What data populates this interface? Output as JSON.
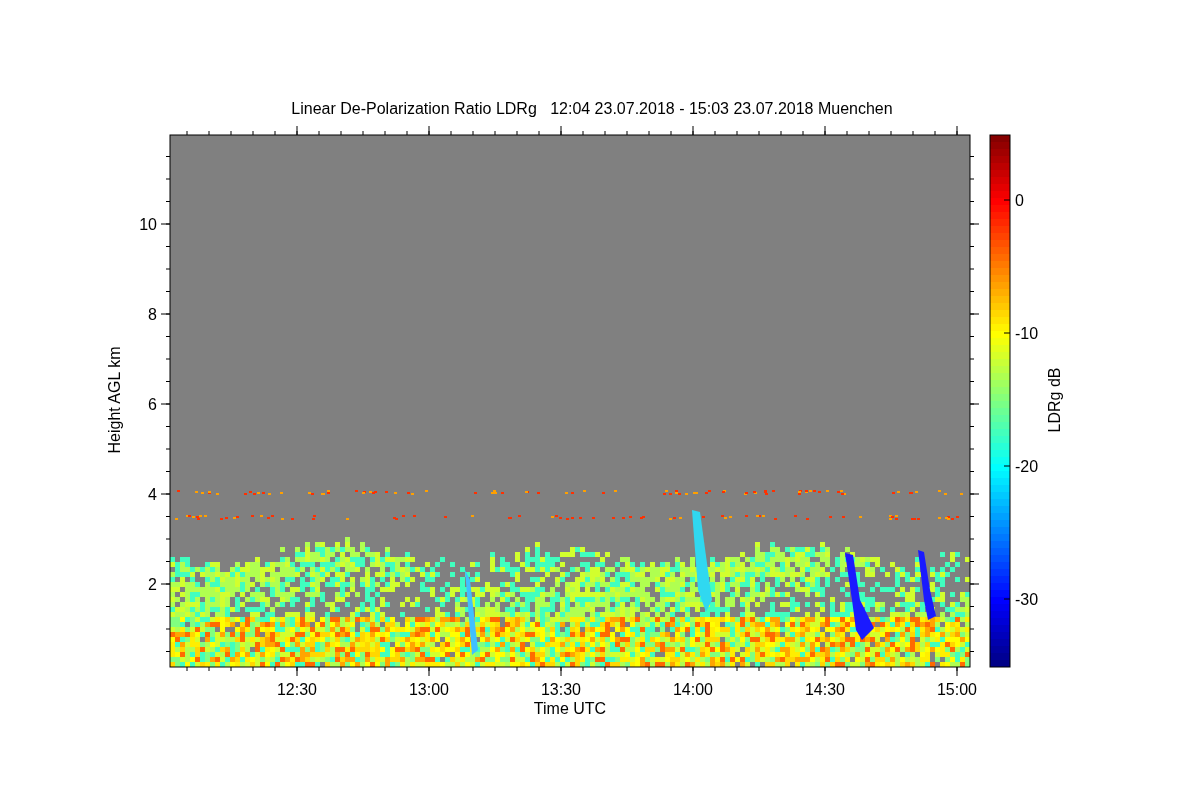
{
  "title": "Linear De-Polarization Ratio LDRg   12:04 23.07.2018 - 15:03 23.07.2018 Muenchen",
  "plot": {
    "xlabel": "Time UTC",
    "ylabel": "Height AGL km",
    "xticks": [
      "12:30",
      "13:00",
      "13:30",
      "14:00",
      "14:30",
      "15:00"
    ],
    "yticks": [
      "10",
      "8",
      "6",
      "4",
      "2"
    ]
  },
  "colorbar": {
    "label": "LDRg dB",
    "ticks": [
      "0",
      "-10",
      "-20",
      "-30"
    ]
  }
}
